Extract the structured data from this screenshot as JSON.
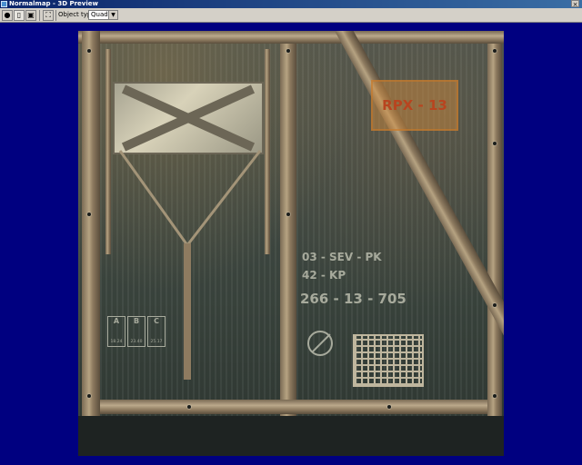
{
  "window": {
    "title": "Normalmap - 3D Preview",
    "close_glyph": "×"
  },
  "toolbar": {
    "buttons": [
      {
        "name": "sphere-view-button",
        "icon": "sphere-icon",
        "glyph": "●"
      },
      {
        "name": "light-button",
        "icon": "light-icon",
        "glyph": "▯"
      },
      {
        "name": "image-button",
        "icon": "image-icon",
        "glyph": "▣"
      },
      {
        "name": "fit-view-button",
        "icon": "fit-icon",
        "glyph": "⛶"
      }
    ],
    "object_type_label": "Object type:",
    "object_type_value": "Quad",
    "dropdown_glyph": "▼"
  },
  "texture": {
    "rpx_label": "RPX - 13",
    "stencil_line1": "03 - SEV - PK",
    "stencil_line2": "42 - KP",
    "stencil_line3": "266 - 13 - 705",
    "abc_cells": [
      {
        "letter": "A",
        "value": "18.24"
      },
      {
        "letter": "B",
        "value": "23.40"
      },
      {
        "letter": "C",
        "value": "25.17"
      }
    ]
  }
}
